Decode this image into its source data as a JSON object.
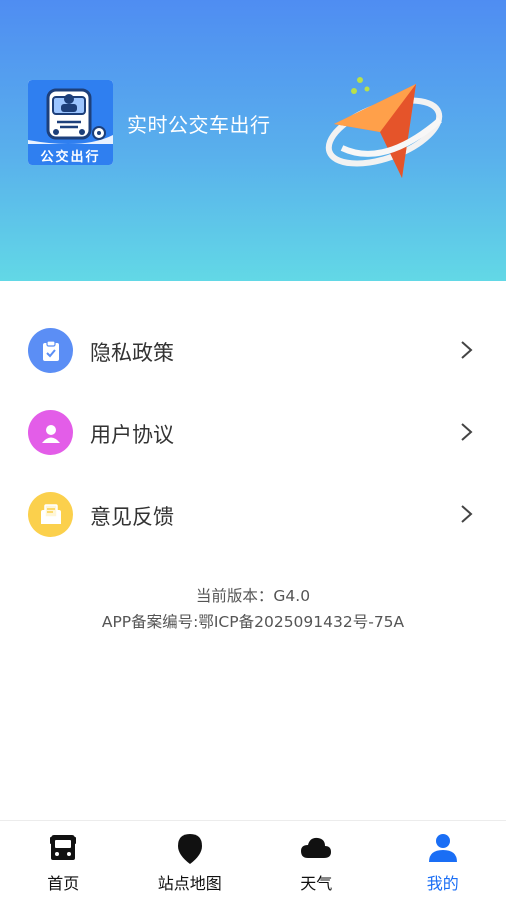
{
  "header": {
    "logo_caption": "公交出行",
    "app_title": "实时公交车出行"
  },
  "menu": {
    "items": [
      {
        "label": "隐私政策",
        "icon": "clipboard-check-icon",
        "color": "#5b8ef5"
      },
      {
        "label": "用户协议",
        "icon": "user-icon",
        "color": "#e35de8"
      },
      {
        "label": "意见反馈",
        "icon": "feedback-mail-icon",
        "color": "#fbd04c"
      }
    ]
  },
  "info": {
    "version": "当前版本：G4.0",
    "icp": "APP备案编号:鄂ICP备2025091432号-75A"
  },
  "tabbar": {
    "tabs": [
      {
        "label": "首页",
        "icon": "bus-icon"
      },
      {
        "label": "站点地图",
        "icon": "location-pin-icon"
      },
      {
        "label": "天气",
        "icon": "cloud-icon"
      },
      {
        "label": "我的",
        "icon": "person-icon",
        "active": true
      }
    ],
    "active_color": "#1a6ef5"
  }
}
